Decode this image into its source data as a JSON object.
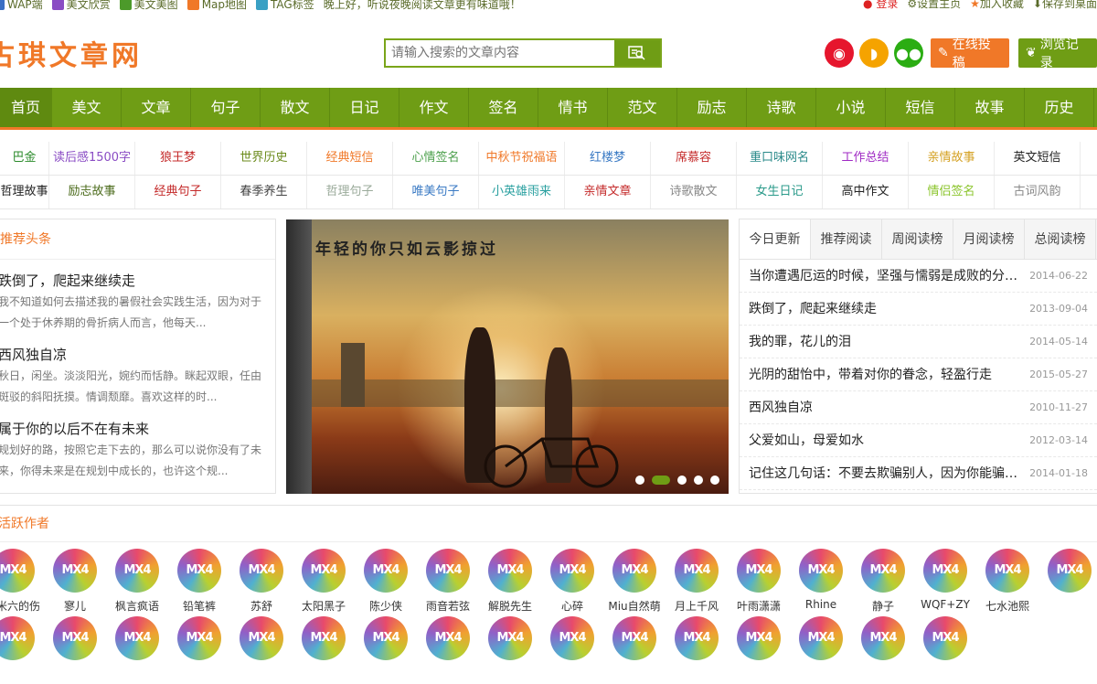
{
  "topbar": {
    "links": [
      {
        "label": "WAP端",
        "color": "#3a6fc4"
      },
      {
        "label": "美文欣赏",
        "color": "#8a4cc4"
      },
      {
        "label": "美文美图",
        "color": "#4c9a2a"
      },
      {
        "label": "Map地图",
        "color": "#f07828"
      },
      {
        "label": "TAG标签",
        "color": "#3aa0c4"
      }
    ],
    "greeting": "晚上好，听说夜晚阅读文章更有味道哦！",
    "login": "登录",
    "set_home": "设置主页",
    "add_fav": "加入收藏",
    "save_desktop": "保存到桌面"
  },
  "header": {
    "logo": "古琪文章网",
    "search_placeholder": "请输入搜索的文章内容",
    "submit_label": "在线投稿",
    "history_label": "浏览记录"
  },
  "nav": [
    "首页",
    "美文",
    "文章",
    "句子",
    "散文",
    "日记",
    "作文",
    "签名",
    "情书",
    "范文",
    "励志",
    "诗歌",
    "小说",
    "短信",
    "故事",
    "历史"
  ],
  "tags": [
    [
      {
        "label": "巴金",
        "color": "#2a8a2a"
      },
      {
        "label": "读后感1500字",
        "color": "#8a4cc4"
      },
      {
        "label": "狼王梦",
        "color": "#c42a2a"
      },
      {
        "label": "世界历史",
        "color": "#6a8a1a"
      },
      {
        "label": "经典短信",
        "color": "#f07828"
      },
      {
        "label": "心情签名",
        "color": "#4ca04c"
      },
      {
        "label": "中秋节祝福语",
        "color": "#f07828"
      },
      {
        "label": "红楼梦",
        "color": "#3a7ac4"
      },
      {
        "label": "席慕容",
        "color": "#c42a2a"
      },
      {
        "label": "重口味网名",
        "color": "#2a8a8a"
      },
      {
        "label": "工作总结",
        "color": "#a02ac4"
      },
      {
        "label": "亲情故事",
        "color": "#d4a020"
      },
      {
        "label": "英文短信",
        "color": "#222222"
      }
    ],
    [
      {
        "label": "哲理故事",
        "color": "#222222"
      },
      {
        "label": "励志故事",
        "color": "#4a6a1a"
      },
      {
        "label": "经典句子",
        "color": "#c42a2a"
      },
      {
        "label": "春季养生",
        "color": "#444444"
      },
      {
        "label": "哲理句子",
        "color": "#9aaa9a"
      },
      {
        "label": "唯美句子",
        "color": "#3a7ac4"
      },
      {
        "label": "小英雄雨来",
        "color": "#2aa0a0"
      },
      {
        "label": "亲情文章",
        "color": "#c42a2a"
      },
      {
        "label": "诗歌散文",
        "color": "#888888"
      },
      {
        "label": "女生日记",
        "color": "#2a9a8a"
      },
      {
        "label": "高中作文",
        "color": "#222222"
      },
      {
        "label": "情侣签名",
        "color": "#8ac42a"
      },
      {
        "label": "古词风韵",
        "color": "#888888"
      }
    ]
  ],
  "recommended": {
    "heading": "推荐头条",
    "articles": [
      {
        "title": "跌倒了，爬起来继续走",
        "summary": "我不知道如何去描述我的暑假社会实践生活，因为对于一个处于休养期的骨折病人而言，他每天..."
      },
      {
        "title": "西风独自凉",
        "summary": "秋日，闲坐。淡淡阳光，婉约而恬静。眯起双眼，任由斑驳的斜阳抚摸。情调颓靡。喜欢这样的时..."
      },
      {
        "title": "属于你的以后不在有未来",
        "summary": "规划好的路，按照它走下去的，那么可以说你没有了未来，你得未来是在规划中成长的，也许这个规..."
      }
    ]
  },
  "banner": {
    "caption": "年轻的你只如云影掠过",
    "slide_count": 5,
    "active_slide": 2
  },
  "updates": {
    "tabs": [
      "今日更新",
      "推荐阅读",
      "周阅读榜",
      "月阅读榜",
      "总阅读榜"
    ],
    "items": [
      {
        "title": "当你遭遇厄运的时候，坚强与懦弱是成败的分水岭",
        "date": "2014-06-22"
      },
      {
        "title": "跌倒了，爬起来继续走",
        "date": "2013-09-04"
      },
      {
        "title": "我的罪，花儿的泪",
        "date": "2014-05-14"
      },
      {
        "title": "光阴的甜怡中，带着对你的眷念，轻盈行走",
        "date": "2015-05-27"
      },
      {
        "title": "西风独自凉",
        "date": "2010-11-27"
      },
      {
        "title": "父爱如山，母爱如水",
        "date": "2012-03-14"
      },
      {
        "title": "记住这几句话：不要去欺骗别人，因为你能骗到的人",
        "date": "2014-01-18"
      }
    ]
  },
  "authors": {
    "heading": "活跃作者",
    "avatar_text": "MX4",
    "names": [
      "一米六的伤",
      "寥儿",
      "枫言疯语",
      "铅笔裤",
      "苏舒",
      "太阳黑子",
      "陈少侠",
      "雨音若弦",
      "解脱先生",
      "心碎",
      "Miu自然萌",
      "月上千风",
      "叶雨潇潇",
      "Rhine",
      "静子",
      "WQF+ZY",
      "七水池熙",
      "",
      "",
      "",
      "",
      "",
      "",
      "",
      "",
      "",
      "",
      "",
      "",
      "",
      "",
      "",
      "",
      ""
    ]
  },
  "icons": {
    "weibo": "weibo-icon",
    "qq": "qq-icon",
    "wechat": "wechat-icon"
  },
  "colors": {
    "brand_green": "#6f9d15",
    "accent_orange": "#f07828"
  }
}
